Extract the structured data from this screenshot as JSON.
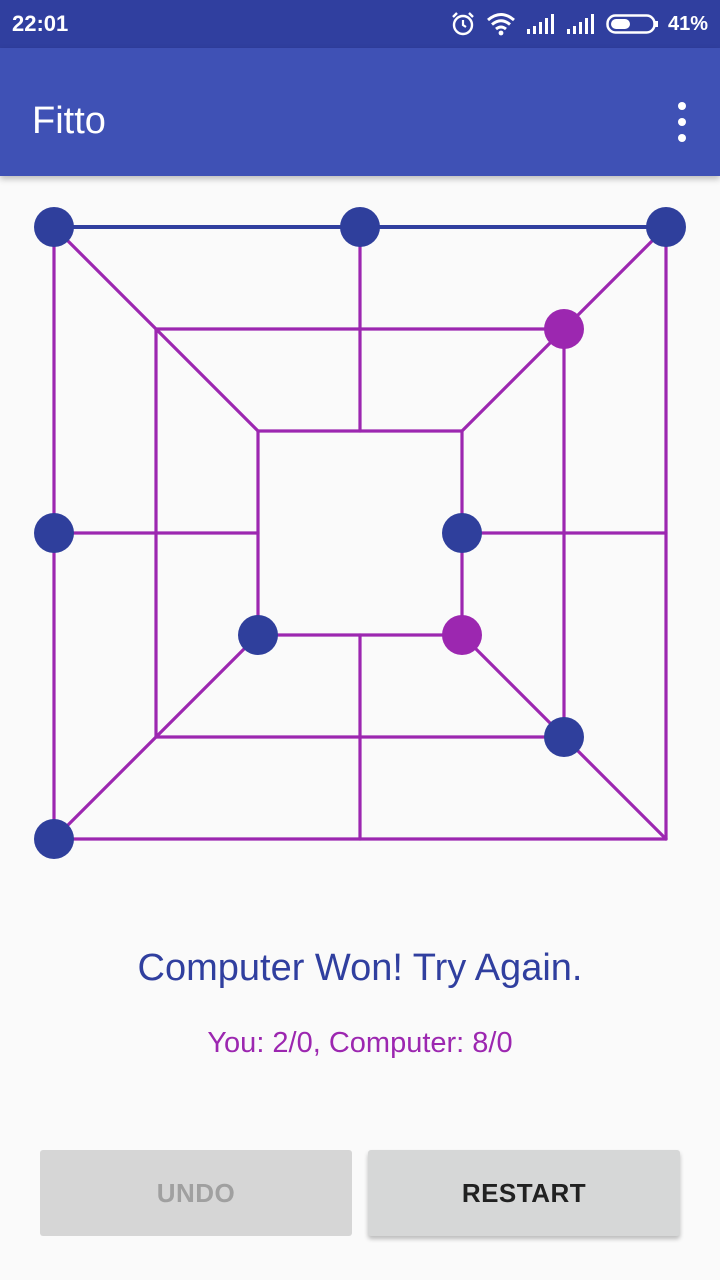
{
  "status_bar": {
    "time": "22:01",
    "battery_percent": "41%",
    "icons": [
      "alarm-icon",
      "wifi-icon",
      "signal-icon",
      "signal-icon",
      "battery-icon"
    ]
  },
  "app_bar": {
    "title": "Fitto",
    "menu_icon": "overflow-menu-icon"
  },
  "colors": {
    "primary": "#3f51b5",
    "primary_dark": "#303f9f",
    "accent": "#9c27b0",
    "player_piece": "#2f3f9c",
    "computer_piece": "#9c27b0"
  },
  "board": {
    "pieces": [
      {
        "point": "outer-top-left",
        "owner": "blue"
      },
      {
        "point": "outer-top-middle",
        "owner": "blue"
      },
      {
        "point": "outer-top-right",
        "owner": "blue"
      },
      {
        "point": "middle-top-right",
        "owner": "purple"
      },
      {
        "point": "outer-middle-left",
        "owner": "blue"
      },
      {
        "point": "inner-middle-right",
        "owner": "blue"
      },
      {
        "point": "inner-bottom-left",
        "owner": "blue"
      },
      {
        "point": "inner-bottom-right",
        "owner": "purple"
      },
      {
        "point": "middle-bottom-right",
        "owner": "blue"
      },
      {
        "point": "outer-bottom-left",
        "owner": "blue"
      }
    ]
  },
  "message": "Computer Won! Try Again.",
  "score": "You: 2/0, Computer: 8/0",
  "buttons": {
    "undo": "UNDO",
    "restart": "RESTART"
  }
}
